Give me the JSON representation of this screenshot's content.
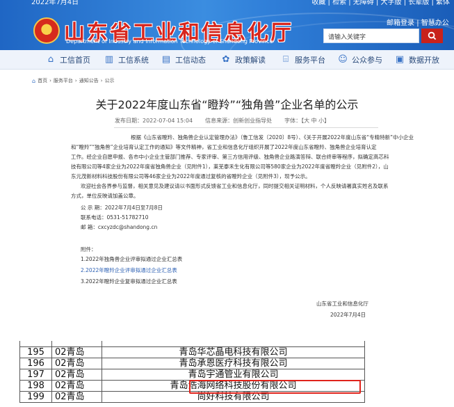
{
  "header": {
    "top_date": "2022年7月4日",
    "top_links": "收藏 | 检索 | 无障碍 | 大字版 | 长辈版 | 繁体",
    "site_title": "山东省工业和信息化厅",
    "site_subtitle": "Department of Industry and Information Technology of Shandong Province",
    "mail_login": "邮箱登录",
    "secondary_link": "智慧办公",
    "search_placeholder": "请输入关键字",
    "colors": {
      "header_blue": "#2f7ed8",
      "brand_red": "#d7261e",
      "search_red": "#c8221b"
    }
  },
  "nav": [
    {
      "label": "工信首页",
      "icon": "home-icon"
    },
    {
      "label": "工信系统",
      "icon": "building-icon"
    },
    {
      "label": "工信动态",
      "icon": "news-icon"
    },
    {
      "label": "政策解读",
      "icon": "handshake-icon"
    },
    {
      "label": "服务平台",
      "icon": "bank-icon"
    },
    {
      "label": "公众参与",
      "icon": "people-icon"
    },
    {
      "label": "数据开放",
      "icon": "data-icon"
    }
  ],
  "breadcrumb": [
    "首页",
    "服务平台",
    "通知公告",
    "公示"
  ],
  "article": {
    "title": "关于2022年度山东省“瞪羚”“独角兽”企业名单的公示",
    "publish_label": "发布日期：2022-07-04 15:04",
    "source_label": "信息来源：创新创业指导处",
    "font_size_label": "字体：【大 中 小】",
    "paragraphs": [
      "根据《山东省瞪羚、独角兽企业认定管理办法》（鲁工信发〔2020〕8号）、《关于开展2022年度山东省“专精特新”中小企业",
      "和“瞪羚”“独角兽”企业培育认定工作的通知》等文件精神，省工业和信息化厅组织开展了2022年度山东省瞪羚、独角兽企业培育认定",
      "工作。经企业自愿申报、各市中小企业主管部门推荐、专家评审、第三方信用评级、独角兽企业路演答辩、联合终审等程序，拟确定高芯科",
      "技有限公司等4家企业为2022年度省独角兽企业（见附件1），莱芜泰禾生化有限公司等580家企业为2022年度省瞪羚企业（见附件2），山",
      "东元茂新材料科技股份有限公司等46家企业为2022年度通过复核的省瞪羚企业（见附件3），现予公示。",
      "欢迎社会各界参与监督，相关意见及建议请以书面形式反馈省工业和信息化厅，同时提交相关证明材料，个人反映请署真实姓名及联系",
      "方式，单位反映请加盖公章。"
    ],
    "period": "公 示 期：2022年7月4日至7月8日",
    "phone": "联系电话：0531-51782710",
    "email": "邮    箱：cxcyzdc@shandong.cn",
    "attachments_label": "附件：",
    "attachments": [
      "1.2022年独角兽企业评审拟通过企业汇总表",
      "2.2022年瞪羚企业评审拟通过企业汇总表",
      "3.2022年瞪羚企业复审拟通过企业汇总表"
    ],
    "signature_org": "山东省工业和信息化厅",
    "signature_date": "2022年7月4日"
  },
  "sheet": {
    "rows": [
      {
        "num": "195",
        "region": "02青岛",
        "name": "青岛华芯晶电科技有限公司"
      },
      {
        "num": "196",
        "region": "02青岛",
        "name": "青岛承恩医疗科技有限公司"
      },
      {
        "num": "197",
        "region": "02青岛",
        "name": "青岛宇通管业有限公司"
      },
      {
        "num": "198",
        "region": "02青岛",
        "name": "青岛浩海网络科技股份有限公司"
      },
      {
        "num": "199",
        "region": "02青岛",
        "name": "尚好科技有限公司"
      }
    ],
    "highlight_color": "#e0231b"
  }
}
